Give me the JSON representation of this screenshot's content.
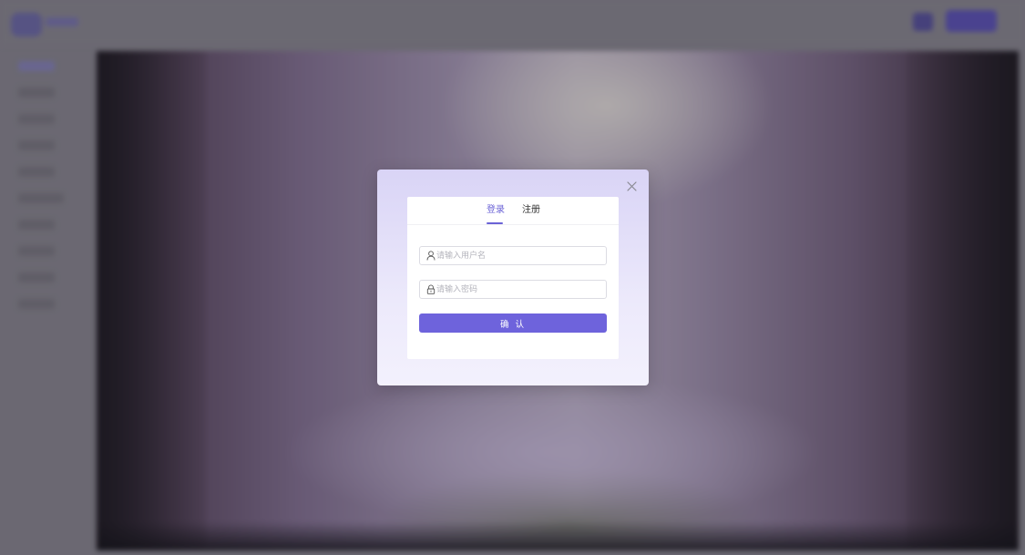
{
  "login_modal": {
    "tabs": [
      {
        "label": "登录",
        "active": true
      },
      {
        "label": "注册",
        "active": false
      }
    ],
    "username_placeholder": "请输入用户名",
    "password_placeholder": "请输入密码",
    "submit_label": "确 认",
    "close_icon": "close-icon"
  },
  "colors": {
    "accent": "#6e63dc",
    "active_tab": "#6b63d6",
    "modal_gradient_top": "#d9d4f6",
    "modal_gradient_bottom": "#f3f1fd"
  },
  "icons": {
    "username": "user-icon",
    "password": "lock-icon"
  }
}
